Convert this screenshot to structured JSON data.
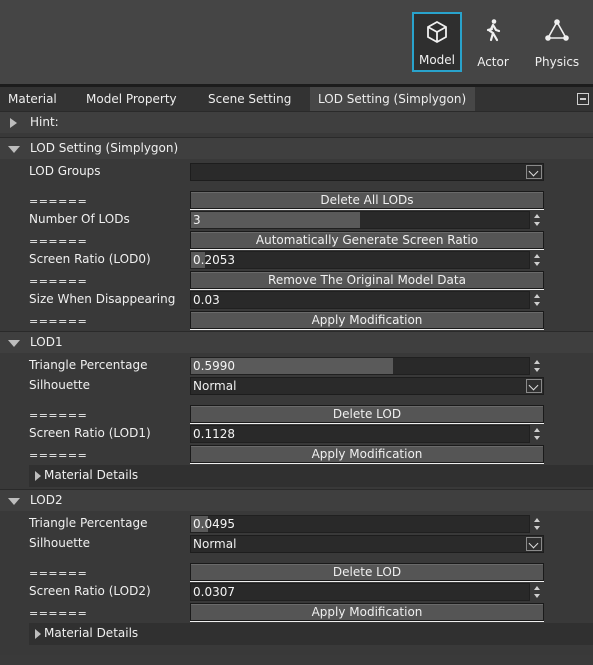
{
  "toolbar": {
    "modes": [
      {
        "label": "Model",
        "icon": "cube-icon",
        "active": true
      },
      {
        "label": "Actor",
        "icon": "walking-person-icon",
        "active": false
      },
      {
        "label": "Physics",
        "icon": "physics-triangle-icon",
        "active": false
      }
    ]
  },
  "tabs": {
    "material": "Material",
    "model_property": "Model Property",
    "scene_setting": "Scene Setting",
    "lod_setting": "LOD Setting (Simplygon)",
    "active": "lod_setting"
  },
  "hint": {
    "label": "Hint:"
  },
  "lod_setting": {
    "title": "LOD Setting (Simplygon)",
    "lod_groups_label": "LOD Groups",
    "lod_groups_value": "",
    "sep": "======",
    "delete_all_label": "Delete All LODs",
    "num_lods_label": "Number Of LODs",
    "num_lods_value": "3",
    "num_lods_fill": 0.5,
    "auto_gen_label": "Automatically Generate Screen Ratio",
    "screen_ratio_label": "Screen Ratio (LOD0)",
    "screen_ratio_value": "0.2053",
    "screen_ratio_fill": 0.04,
    "remove_original_label": "Remove The Original Model Data",
    "size_disappear_label": "Size When Disappearing",
    "size_disappear_value": "0.03",
    "size_disappear_fill": 0.0,
    "apply_label": "Apply Modification"
  },
  "lod1": {
    "title": "LOD1",
    "triangle_label": "Triangle Percentage",
    "triangle_value": "0.5990",
    "triangle_fill": 0.599,
    "silhouette_label": "Silhouette",
    "silhouette_value": "Normal",
    "sep": "======",
    "delete_label": "Delete LOD",
    "screen_ratio_label": "Screen Ratio (LOD1)",
    "screen_ratio_value": "0.1128",
    "screen_ratio_fill": 0.0,
    "apply_label": "Apply Modification",
    "material_details_label": "Material Details"
  },
  "lod2": {
    "title": "LOD2",
    "triangle_label": "Triangle Percentage",
    "triangle_value": "0.0495",
    "triangle_fill": 0.05,
    "silhouette_label": "Silhouette",
    "silhouette_value": "Normal",
    "sep": "======",
    "delete_label": "Delete LOD",
    "screen_ratio_label": "Screen Ratio (LOD2)",
    "screen_ratio_value": "0.0307",
    "screen_ratio_fill": 0.0,
    "apply_label": "Apply Modification",
    "material_details_label": "Material Details"
  },
  "colors": {
    "accent": "#29a3cc",
    "panel_bg": "#393939",
    "button_bg": "#555555",
    "input_bg": "#292929"
  }
}
